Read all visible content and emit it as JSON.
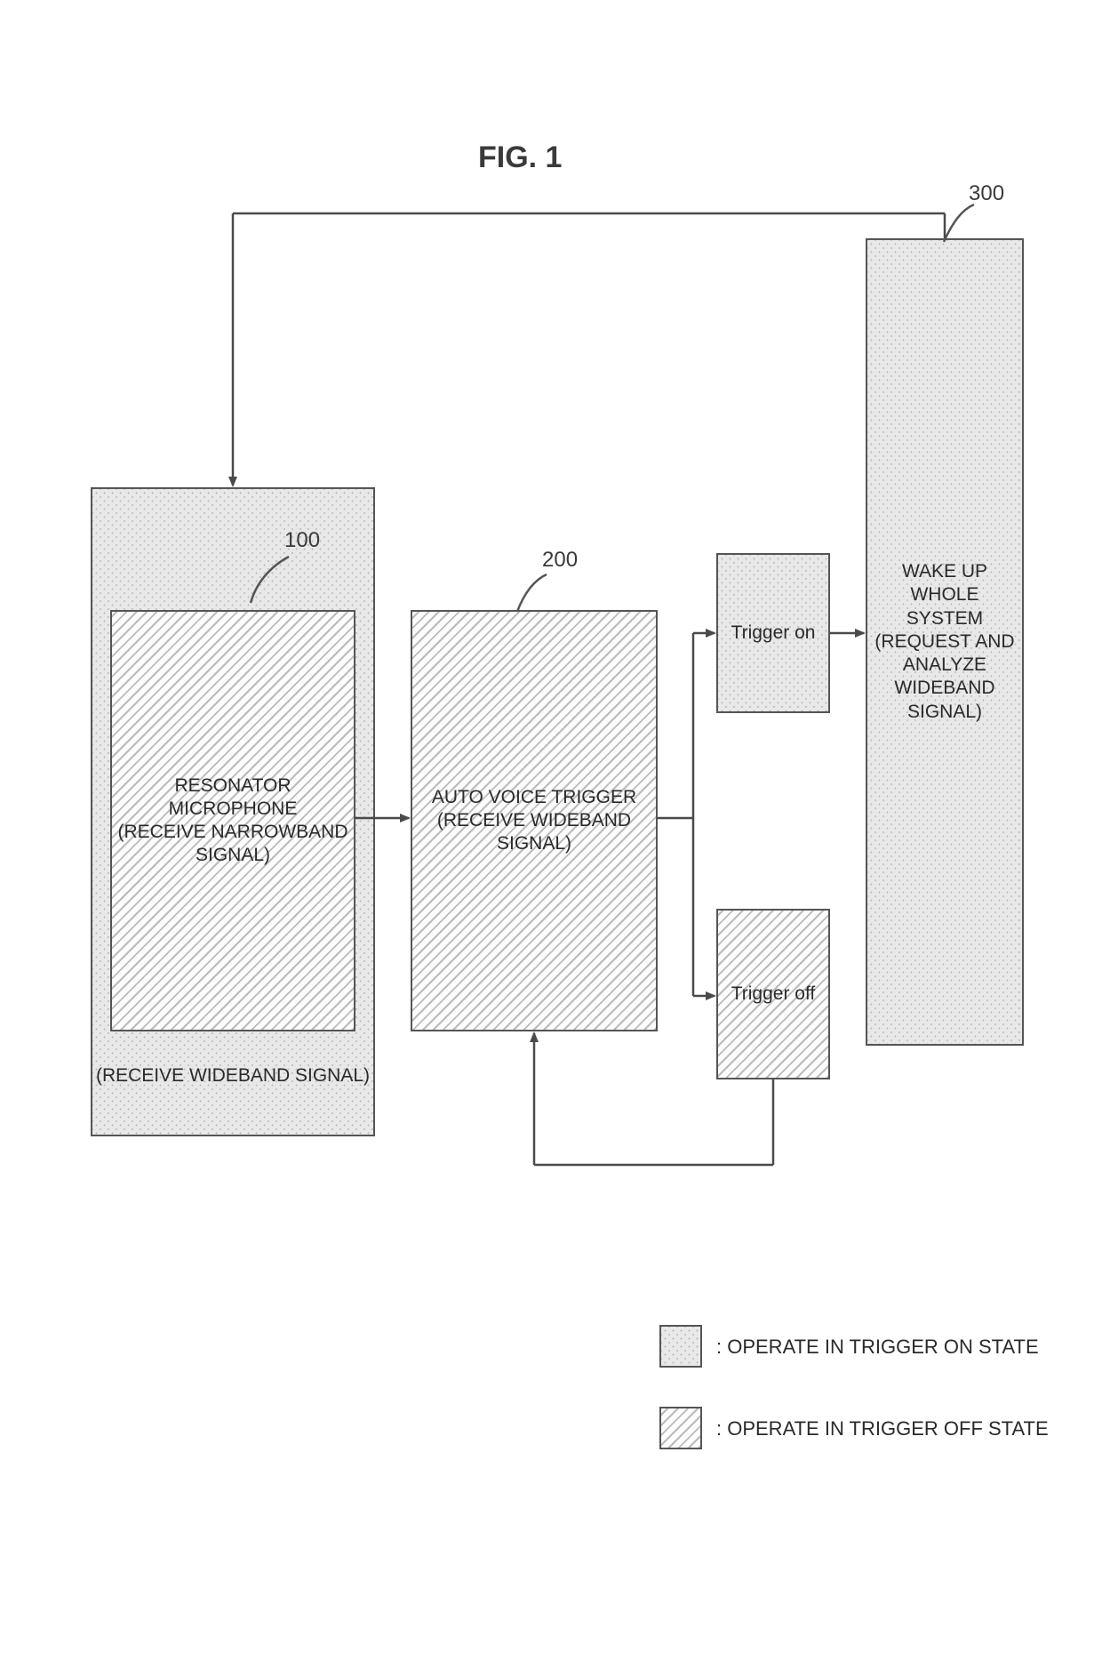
{
  "title": "FIG.  1",
  "ref_100": "100",
  "ref_200": "200",
  "ref_300": "300",
  "outer_box": "(RECEIVE WIDEBAND SIGNAL)",
  "resonator_l1": "RESONATOR MICROPHONE",
  "resonator_l2": "(RECEIVE NARROWBAND",
  "resonator_l3": "SIGNAL)",
  "avt_l1": "AUTO VOICE TRIGGER",
  "avt_l2": "(RECEIVE WIDEBAND SIGNAL)",
  "trig_on": "Trigger on",
  "trig_off": "Trigger off",
  "wake_l1": "WAKE UP WHOLE SYSTEM",
  "wake_l2": "(REQUEST AND ANALYZE",
  "wake_l3": "WIDEBAND SIGNAL)",
  "legend_on": ": OPERATE IN TRIGGER ON STATE",
  "legend_off": ": OPERATE IN TRIGGER OFF STATE"
}
